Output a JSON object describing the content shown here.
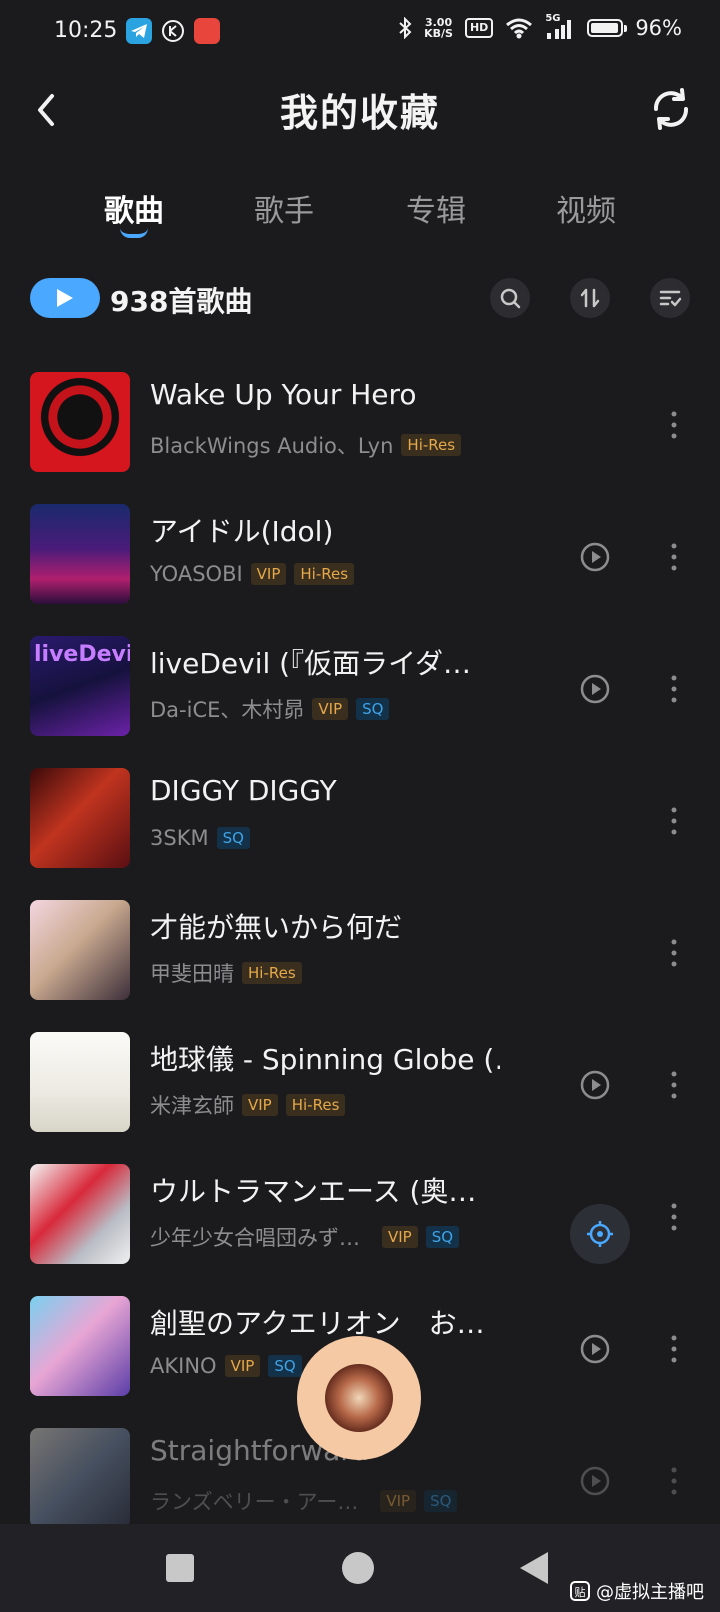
{
  "status_bar": {
    "time": "10:25",
    "net_speed_value": "3.00",
    "net_speed_unit": "KB/S",
    "hd_label": "HD",
    "signal_label": "5G",
    "battery_level": 0.96,
    "battery_text": "96%"
  },
  "header": {
    "title": "我的收藏"
  },
  "tabs": [
    {
      "label": "歌曲",
      "active": true
    },
    {
      "label": "歌手",
      "active": false
    },
    {
      "label": "专辑",
      "active": false
    },
    {
      "label": "视频",
      "active": false
    }
  ],
  "summary": {
    "count_label": "938首歌曲"
  },
  "songs": [
    {
      "title": "Wake Up Your Hero",
      "artist": "BlackWings Audio、Lyn",
      "badges": [
        "Hi-Res"
      ],
      "has_mv": false
    },
    {
      "title": "アイドル(Idol)",
      "artist": "YOASOBI",
      "badges": [
        "VIP",
        "Hi-Res"
      ],
      "has_mv": true
    },
    {
      "title": "liveDevil (『仮面ライダ…",
      "artist": "Da-iCE、木村昴",
      "badges": [
        "VIP",
        "SQ"
      ],
      "has_mv": true
    },
    {
      "title": "DIGGY DIGGY",
      "artist": "3SKM",
      "badges": [
        "SQ"
      ],
      "has_mv": false
    },
    {
      "title": "才能が無いから何だ",
      "artist": "甲斐田晴",
      "badges": [
        "Hi-Res"
      ],
      "has_mv": false
    },
    {
      "title": "地球儀 - Spinning Globe (…",
      "artist": "米津玄師",
      "badges": [
        "VIP",
        "Hi-Res"
      ],
      "has_mv": true
    },
    {
      "title": "ウルトラマンエース (奥…",
      "artist": "少年少女合唱団みず…",
      "badges": [
        "VIP",
        "SQ"
      ],
      "has_mv": false
    },
    {
      "title": "創聖のアクエリオン　お…",
      "artist": "AKINO",
      "badges": [
        "VIP",
        "SQ"
      ],
      "has_mv": true
    },
    {
      "title": "Straightforward",
      "artist": "ランズベリー・アー…",
      "badges": [
        "VIP",
        "SQ"
      ],
      "has_mv": true
    }
  ],
  "watermark": {
    "text": "@虚拟主播吧",
    "icon_glyph": "贴"
  },
  "colors": {
    "background": "#1b1b1d",
    "accent": "#4aa8ff",
    "hires_badge": "#e5a84a",
    "sq_badge": "#3fa3e6",
    "mini_player": "#f5c9a4"
  }
}
